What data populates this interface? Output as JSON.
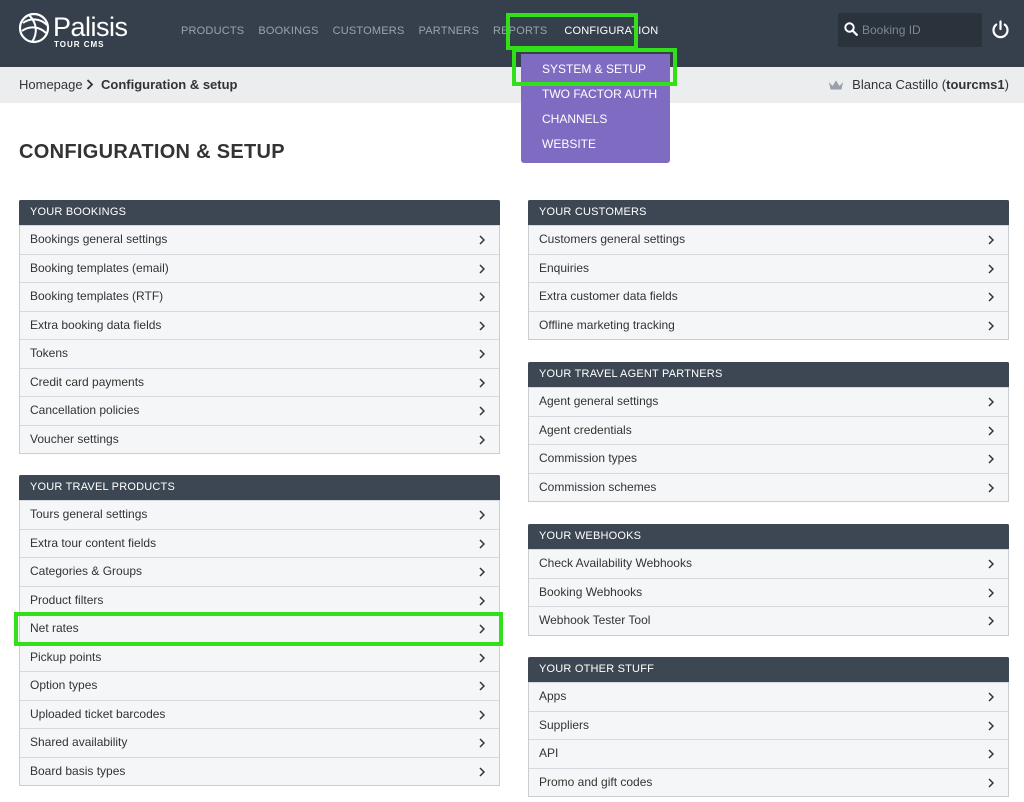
{
  "brand": {
    "name": "Palisis",
    "sub": "TOUR CMS"
  },
  "nav": [
    "PRODUCTS",
    "BOOKINGS",
    "CUSTOMERS",
    "PARTNERS",
    "REPORTS",
    "CONFIGURATION"
  ],
  "search": {
    "placeholder": "Booking ID"
  },
  "breadcrumb": {
    "home": "Homepage",
    "current": "Configuration & setup"
  },
  "user": {
    "name": "Blanca Castillo",
    "account": "tourcms1"
  },
  "dropdown": [
    "SYSTEM & SETUP",
    "TWO FACTOR AUTH",
    "CHANNELS",
    "WEBSITE"
  ],
  "page_title": "CONFIGURATION & SETUP",
  "panels": {
    "bookings": {
      "title": "YOUR BOOKINGS",
      "items": [
        "Bookings general settings",
        "Booking templates (email)",
        "Booking templates (RTF)",
        "Extra booking data fields",
        "Tokens",
        "Credit card payments",
        "Cancellation policies",
        "Voucher settings"
      ]
    },
    "products": {
      "title": "YOUR TRAVEL PRODUCTS",
      "items": [
        "Tours general settings",
        "Extra tour content fields",
        "Categories & Groups",
        "Product filters",
        "Net rates",
        "Pickup points",
        "Option types",
        "Uploaded ticket barcodes",
        "Shared availability",
        "Board basis types"
      ]
    },
    "customers": {
      "title": "YOUR CUSTOMERS",
      "items": [
        "Customers general settings",
        "Enquiries",
        "Extra customer data fields",
        "Offline marketing tracking"
      ]
    },
    "agents": {
      "title": "YOUR TRAVEL AGENT PARTNERS",
      "items": [
        "Agent general settings",
        "Agent credentials",
        "Commission types",
        "Commission schemes"
      ]
    },
    "webhooks": {
      "title": "YOUR WEBHOOKS",
      "items": [
        "Check Availability Webhooks",
        "Booking Webhooks",
        "Webhook Tester Tool"
      ]
    },
    "other": {
      "title": "YOUR OTHER STUFF",
      "items": [
        "Apps",
        "Suppliers",
        "API",
        "Promo and gift codes"
      ]
    }
  },
  "colors": {
    "header": "#36404c",
    "panel_head": "#3d4754",
    "dropdown": "#7f6cc2",
    "highlight": "#31e019"
  }
}
